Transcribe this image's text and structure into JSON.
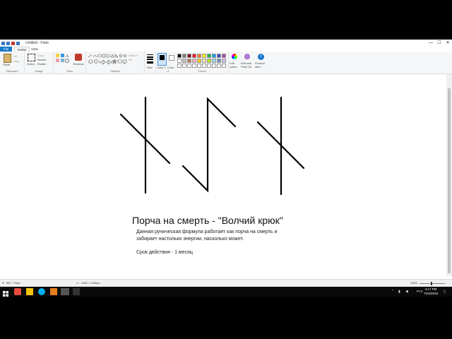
{
  "window": {
    "title": "Untitled - Paint",
    "controls": {
      "minimize": "—",
      "maximize": "☐",
      "close": "✕"
    }
  },
  "tabs": [
    {
      "label": "File"
    },
    {
      "label": "Home"
    },
    {
      "label": "View"
    }
  ],
  "ribbon": {
    "clipboard": {
      "paste": "Paste",
      "cut": "Cut",
      "copy": "Copy",
      "label": "Clipboard"
    },
    "image": {
      "select": "Select",
      "crop": "Crop",
      "resize": "Resize",
      "rotate": "Rotate",
      "label": "Image"
    },
    "tools": {
      "label": "Tools",
      "brushes": "Brushes"
    },
    "shapes": {
      "label": "Shapes",
      "outline": "Outline",
      "fill": "Fill"
    },
    "size": {
      "label": "Size"
    },
    "color1": {
      "label": "Color 1"
    },
    "color2": {
      "label": "Color 2"
    },
    "colors": {
      "label": "Colors"
    },
    "edit_colors": {
      "label": "Edit colors"
    },
    "edit_paint3d": {
      "label": "Edit with Paint 3D"
    },
    "product_alert": {
      "label": "Product alert"
    }
  },
  "palette": [
    "#000000",
    "#7f7f7f",
    "#880015",
    "#ed1c24",
    "#ff7f27",
    "#fff200",
    "#22b14c",
    "#00a2e8",
    "#3f48cc",
    "#a349a4",
    "#ffffff",
    "#c3c3c3",
    "#b97a57",
    "#ffaec9",
    "#ffc90e",
    "#efe4b0",
    "#b5e61d",
    "#99d9ea",
    "#7092be",
    "#c8bfe7"
  ],
  "canvas": {
    "heading": "Порча на смерть - \"Волчий крюк\"",
    "line1": "Данная руническая формула работает как порча на смерть и",
    "line2": "забирает настолько энергии, насколько может.",
    "line3": "Срок действия - 1 месяц"
  },
  "status": {
    "cursor_pos": "987, 776px",
    "image_size": "2460 × 1280px",
    "zoom": "100%"
  },
  "taskbar": {
    "time": "4:17 PM",
    "date": "7/24/2019",
    "lang": "РУС"
  }
}
